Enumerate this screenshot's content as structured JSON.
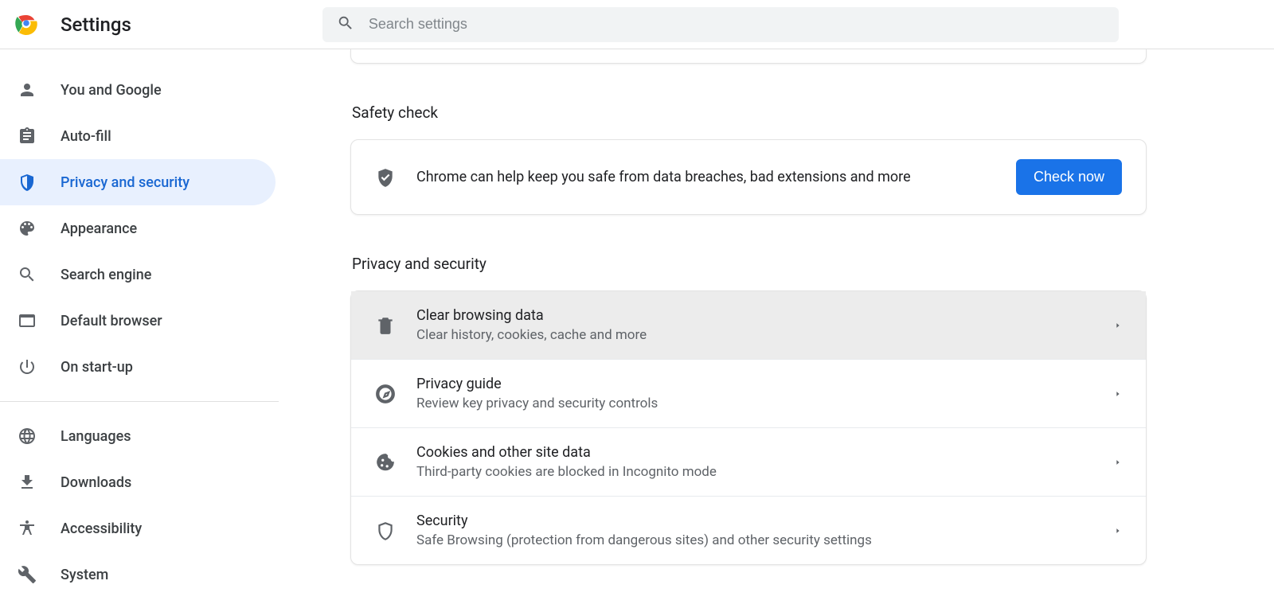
{
  "header": {
    "title": "Settings",
    "search_placeholder": "Search settings"
  },
  "sidebar": {
    "items": [
      {
        "id": "you-google",
        "label": "You and Google",
        "icon": "person"
      },
      {
        "id": "autofill",
        "label": "Auto-fill",
        "icon": "clipboard"
      },
      {
        "id": "privacy",
        "label": "Privacy and security",
        "icon": "shield",
        "active": true
      },
      {
        "id": "appearance",
        "label": "Appearance",
        "icon": "palette"
      },
      {
        "id": "search-engine",
        "label": "Search engine",
        "icon": "search"
      },
      {
        "id": "default-browser",
        "label": "Default browser",
        "icon": "browser"
      },
      {
        "id": "startup",
        "label": "On start-up",
        "icon": "power"
      }
    ],
    "items2": [
      {
        "id": "languages",
        "label": "Languages",
        "icon": "globe"
      },
      {
        "id": "downloads",
        "label": "Downloads",
        "icon": "download"
      },
      {
        "id": "accessibility",
        "label": "Accessibility",
        "icon": "accessibility"
      },
      {
        "id": "system",
        "label": "System",
        "icon": "wrench"
      }
    ]
  },
  "safety": {
    "section_title": "Safety check",
    "text": "Chrome can help keep you safe from data breaches, bad extensions and more",
    "button": "Check now"
  },
  "privacy": {
    "section_title": "Privacy and security",
    "rows": [
      {
        "title": "Clear browsing data",
        "sub": "Clear history, cookies, cache and more",
        "icon": "trash",
        "hover": true
      },
      {
        "title": "Privacy guide",
        "sub": "Review key privacy and security controls",
        "icon": "compass"
      },
      {
        "title": "Cookies and other site data",
        "sub": "Third-party cookies are blocked in Incognito mode",
        "icon": "cookie"
      },
      {
        "title": "Security",
        "sub": "Safe Browsing (protection from dangerous sites) and other security settings",
        "icon": "shield-outline"
      }
    ]
  }
}
